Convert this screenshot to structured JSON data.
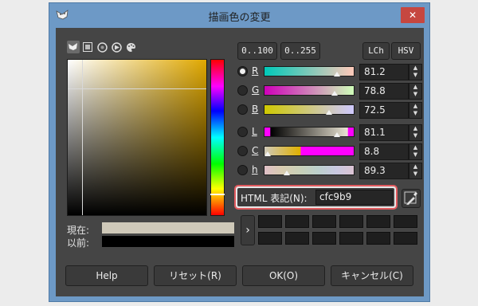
{
  "dialog": {
    "title": "描画色の変更",
    "close_glyph": "✕"
  },
  "scale_buttons": {
    "b100": "0..100",
    "b255": "0..255",
    "lch": "LCh",
    "hsv": "HSV"
  },
  "channels": [
    {
      "label": "R",
      "value": "81.2",
      "checked": true,
      "pos": 0.81
    },
    {
      "label": "G",
      "value": "78.8",
      "checked": false,
      "pos": 0.79
    },
    {
      "label": "B",
      "value": "72.5",
      "checked": false,
      "pos": 0.72
    },
    {
      "label": "L",
      "value": "81.1",
      "checked": false,
      "pos": 0.81
    },
    {
      "label": "C",
      "value": "8.8",
      "checked": false,
      "pos": 0.04
    },
    {
      "label": "h",
      "value": "89.3",
      "checked": false,
      "pos": 0.25
    }
  ],
  "html_notation": {
    "label": "HTML 表記(N):",
    "value": "cfc9b9"
  },
  "swatches": {
    "current_label": "現在:",
    "previous_label": "以前:",
    "current_color": "#cfc9b9",
    "previous_color": "#000000"
  },
  "history_arrow": "›",
  "buttons": {
    "help": "Help",
    "reset": "リセット(R)",
    "ok": "OK(O)",
    "cancel": "キャンセル(C)"
  }
}
